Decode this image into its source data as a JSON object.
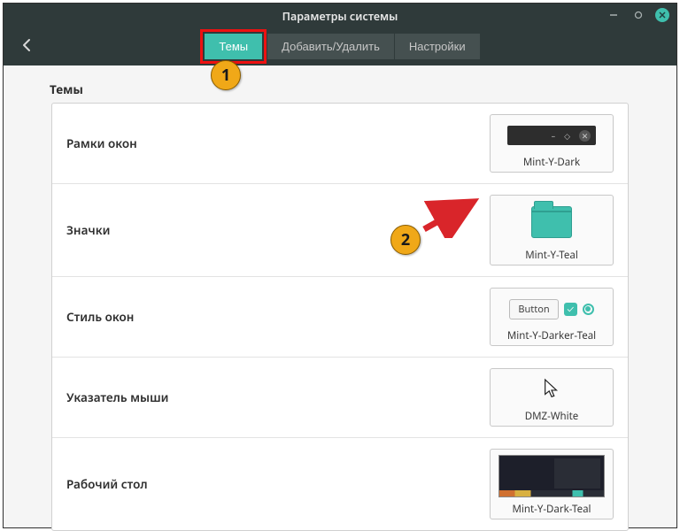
{
  "window": {
    "title": "Параметры системы"
  },
  "tabs": {
    "themes": "Темы",
    "add_remove": "Добавить/Удалить",
    "settings": "Настройки"
  },
  "section": {
    "title": "Темы"
  },
  "rows": {
    "window_borders": {
      "label": "Рамки окон",
      "value": "Mint-Y-Dark"
    },
    "icons": {
      "label": "Значки",
      "value": "Mint-Y-Teal"
    },
    "controls": {
      "label": "Стиль окон",
      "value": "Mint-Y-Darker-Teal",
      "button_text": "Button"
    },
    "mouse_pointer": {
      "label": "Указатель мыши",
      "value": "DMZ-White"
    },
    "desktop": {
      "label": "Рабочий стол",
      "value": "Mint-Y-Dark-Teal"
    }
  },
  "annotations": {
    "marker1": "1",
    "marker2": "2"
  },
  "colors": {
    "accent": "#3fbfad",
    "header_bg": "#2f3a3a",
    "highlight": "#e11",
    "marker": "#f0a818"
  }
}
